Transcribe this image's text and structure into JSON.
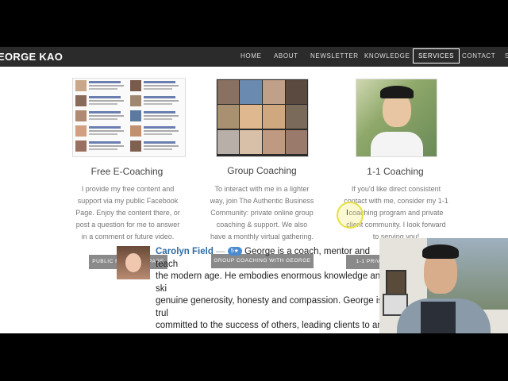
{
  "nav": {
    "brand": "EORGE KAO",
    "items": [
      "HOME",
      "ABOUT",
      "NEWSLETTER",
      "KNOWLEDGE",
      "SERVICES",
      "CONTACT",
      "S"
    ]
  },
  "columns": [
    {
      "title": "Free E-Coaching",
      "lines": [
        "I provide my free content and",
        "support via my public Facebook",
        "Page.  Enjoy the content there, or",
        "post a question for me to answer",
        "in a comment or future video."
      ],
      "button": "PUBLIC FACEBOOK PAGE"
    },
    {
      "title": "Group Coaching",
      "lines": [
        "To interact with me in a lighter",
        "way, join The Authentic Business",
        "Community: private online group",
        "coaching & support.  We also",
        "have a monthly virtual gathering."
      ],
      "button": "GROUP COACHING WITH GEORGE"
    },
    {
      "title": "1-1 Coaching",
      "lines": [
        "If you'd like direct consistent",
        "contact with me, consider my 1-1",
        "coaching program and private",
        "client community.  I look forward",
        "to serving you!"
      ],
      "button": "1-1 PRIVA"
    }
  ],
  "testimonial": {
    "name": "Carolyn Field",
    "dash": "—",
    "badge": "5★",
    "text_first": "George is a coach, mentor and teach",
    "lines": [
      "the modern age. He embodies enormous knowledge and ski",
      "genuine generosity, honesty and compassion. George is trul",
      "committed to the success of others, leading clients to an exp"
    ]
  },
  "colors": {
    "nav_bg": "#2b2b2b",
    "button_bg": "#8a8a8a",
    "name_link": "#2d6ba3"
  }
}
